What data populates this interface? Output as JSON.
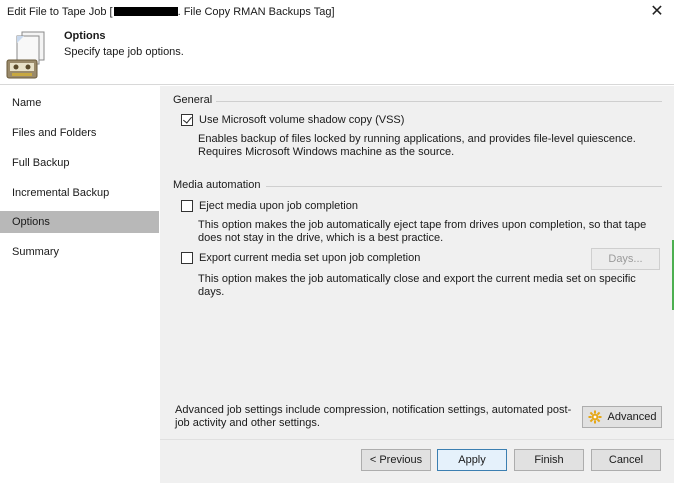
{
  "window": {
    "title_prefix": "Edit File to Tape Job [",
    "title_suffix": ". File Copy RMAN Backups Tag]",
    "close_glyph": "✕"
  },
  "header": {
    "title": "Options",
    "subtitle": "Specify tape job options.",
    "icon": "tape-job-icon"
  },
  "sidebar": {
    "items": [
      {
        "label": "Name",
        "active": false
      },
      {
        "label": "Files and Folders",
        "active": false
      },
      {
        "label": "Full Backup",
        "active": false
      },
      {
        "label": "Incremental Backup",
        "active": false
      },
      {
        "label": "Options",
        "active": true
      },
      {
        "label": "Summary",
        "active": false
      }
    ]
  },
  "general": {
    "title": "General",
    "vss": {
      "checked": true,
      "label": "Use Microsoft volume shadow copy (VSS)",
      "description": "Enables backup of files locked by running applications, and provides file-level quiescence. Requires Microsoft Windows machine as the source."
    }
  },
  "media": {
    "title": "Media automation",
    "eject": {
      "checked": false,
      "label": "Eject media upon job completion",
      "description": "This option makes the job automatically eject tape from drives upon completion, so that tape does not stay in the drive, which is a best practice."
    },
    "export": {
      "checked": false,
      "label": "Export current media set upon job completion",
      "description": "This option makes the job automatically close and export the current media set on specific days.",
      "days_button": "Days..."
    }
  },
  "advanced": {
    "note": "Advanced job settings include compression, notification settings, automated post-job activity and other settings.",
    "button": "Advanced",
    "icon": "gear-icon"
  },
  "footer": {
    "previous": "< Previous",
    "apply": "Apply",
    "finish": "Finish",
    "cancel": "Cancel"
  }
}
